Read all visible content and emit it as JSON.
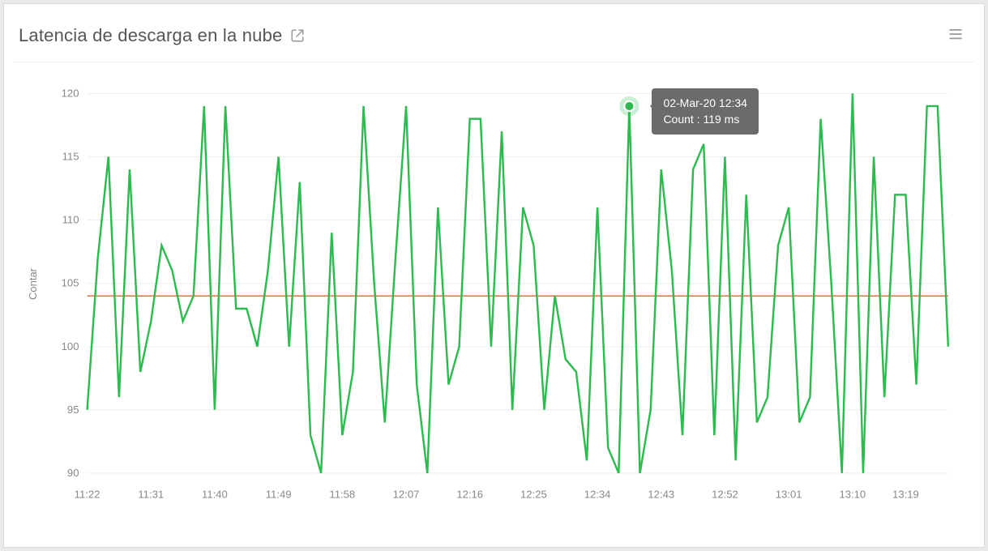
{
  "header": {
    "title": "Latencia de descarga en la nube"
  },
  "chart": {
    "ylabel": "Contar"
  },
  "tooltip": {
    "date": "02-Mar-20 12:34",
    "count_text": "Count : 119 ms"
  },
  "chart_data": {
    "type": "line",
    "title": "Latencia de descarga en la nube",
    "xlabel": "",
    "ylabel": "Contar",
    "ylim": [
      90,
      120
    ],
    "x_tick_labels": [
      "11:22",
      "11:31",
      "11:40",
      "11:49",
      "11:58",
      "12:07",
      "12:16",
      "12:25",
      "12:34",
      "12:43",
      "12:52",
      "13:01",
      "13:10",
      "13:19"
    ],
    "y_ticks": [
      90,
      95,
      100,
      105,
      110,
      115,
      120
    ],
    "reference_line_value": 104,
    "series": [
      {
        "name": "Count",
        "unit": "ms",
        "color": "#2dbb4f",
        "x": [
          "11:22",
          "11:24",
          "11:25",
          "11:27",
          "11:29",
          "11:30",
          "11:31",
          "11:33",
          "11:34",
          "11:36",
          "11:38",
          "11:39",
          "11:40",
          "11:42",
          "11:43",
          "11:45",
          "11:47",
          "11:48",
          "11:49",
          "11:51",
          "11:52",
          "11:54",
          "11:56",
          "11:57",
          "11:58",
          "12:00",
          "12:01",
          "12:03",
          "12:05",
          "12:06",
          "12:07",
          "12:09",
          "12:10",
          "12:12",
          "12:14",
          "12:15",
          "12:16",
          "12:18",
          "12:19",
          "12:21",
          "12:23",
          "12:24",
          "12:25",
          "12:27",
          "12:28",
          "12:30",
          "12:32",
          "12:33",
          "12:34",
          "12:36",
          "12:37",
          "12:39",
          "12:41",
          "12:42",
          "12:43",
          "12:45",
          "12:46",
          "12:48",
          "12:50",
          "12:51",
          "12:52",
          "12:54",
          "12:55",
          "12:57",
          "12:59",
          "13:00",
          "13:01",
          "13:03",
          "13:04",
          "13:06",
          "13:08",
          "13:09",
          "13:10",
          "13:12",
          "13:14",
          "13:15",
          "13:17",
          "13:19",
          "13:20",
          "13:22",
          "13:24"
        ],
        "values": [
          95,
          107,
          115,
          96,
          114,
          98,
          102,
          108,
          106,
          102,
          104,
          119,
          95,
          119,
          103,
          103,
          100,
          106,
          115,
          100,
          113,
          93,
          90,
          109,
          93,
          98,
          119,
          105,
          94,
          107,
          119,
          97,
          90,
          111,
          97,
          100,
          118,
          118,
          100,
          117,
          95,
          111,
          108,
          95,
          104,
          99,
          98,
          91,
          111,
          92,
          90,
          119,
          90,
          95,
          114,
          106,
          93,
          114,
          116,
          93,
          115,
          91,
          112,
          94,
          96,
          108,
          111,
          94,
          96,
          118,
          105,
          90,
          120,
          90,
          115,
          96,
          112,
          112,
          97,
          119,
          119,
          100
        ]
      }
    ],
    "highlight_point": {
      "x": "12:34",
      "value": 119,
      "series": "Count",
      "tooltip_date": "02-Mar-20 12:34"
    }
  }
}
